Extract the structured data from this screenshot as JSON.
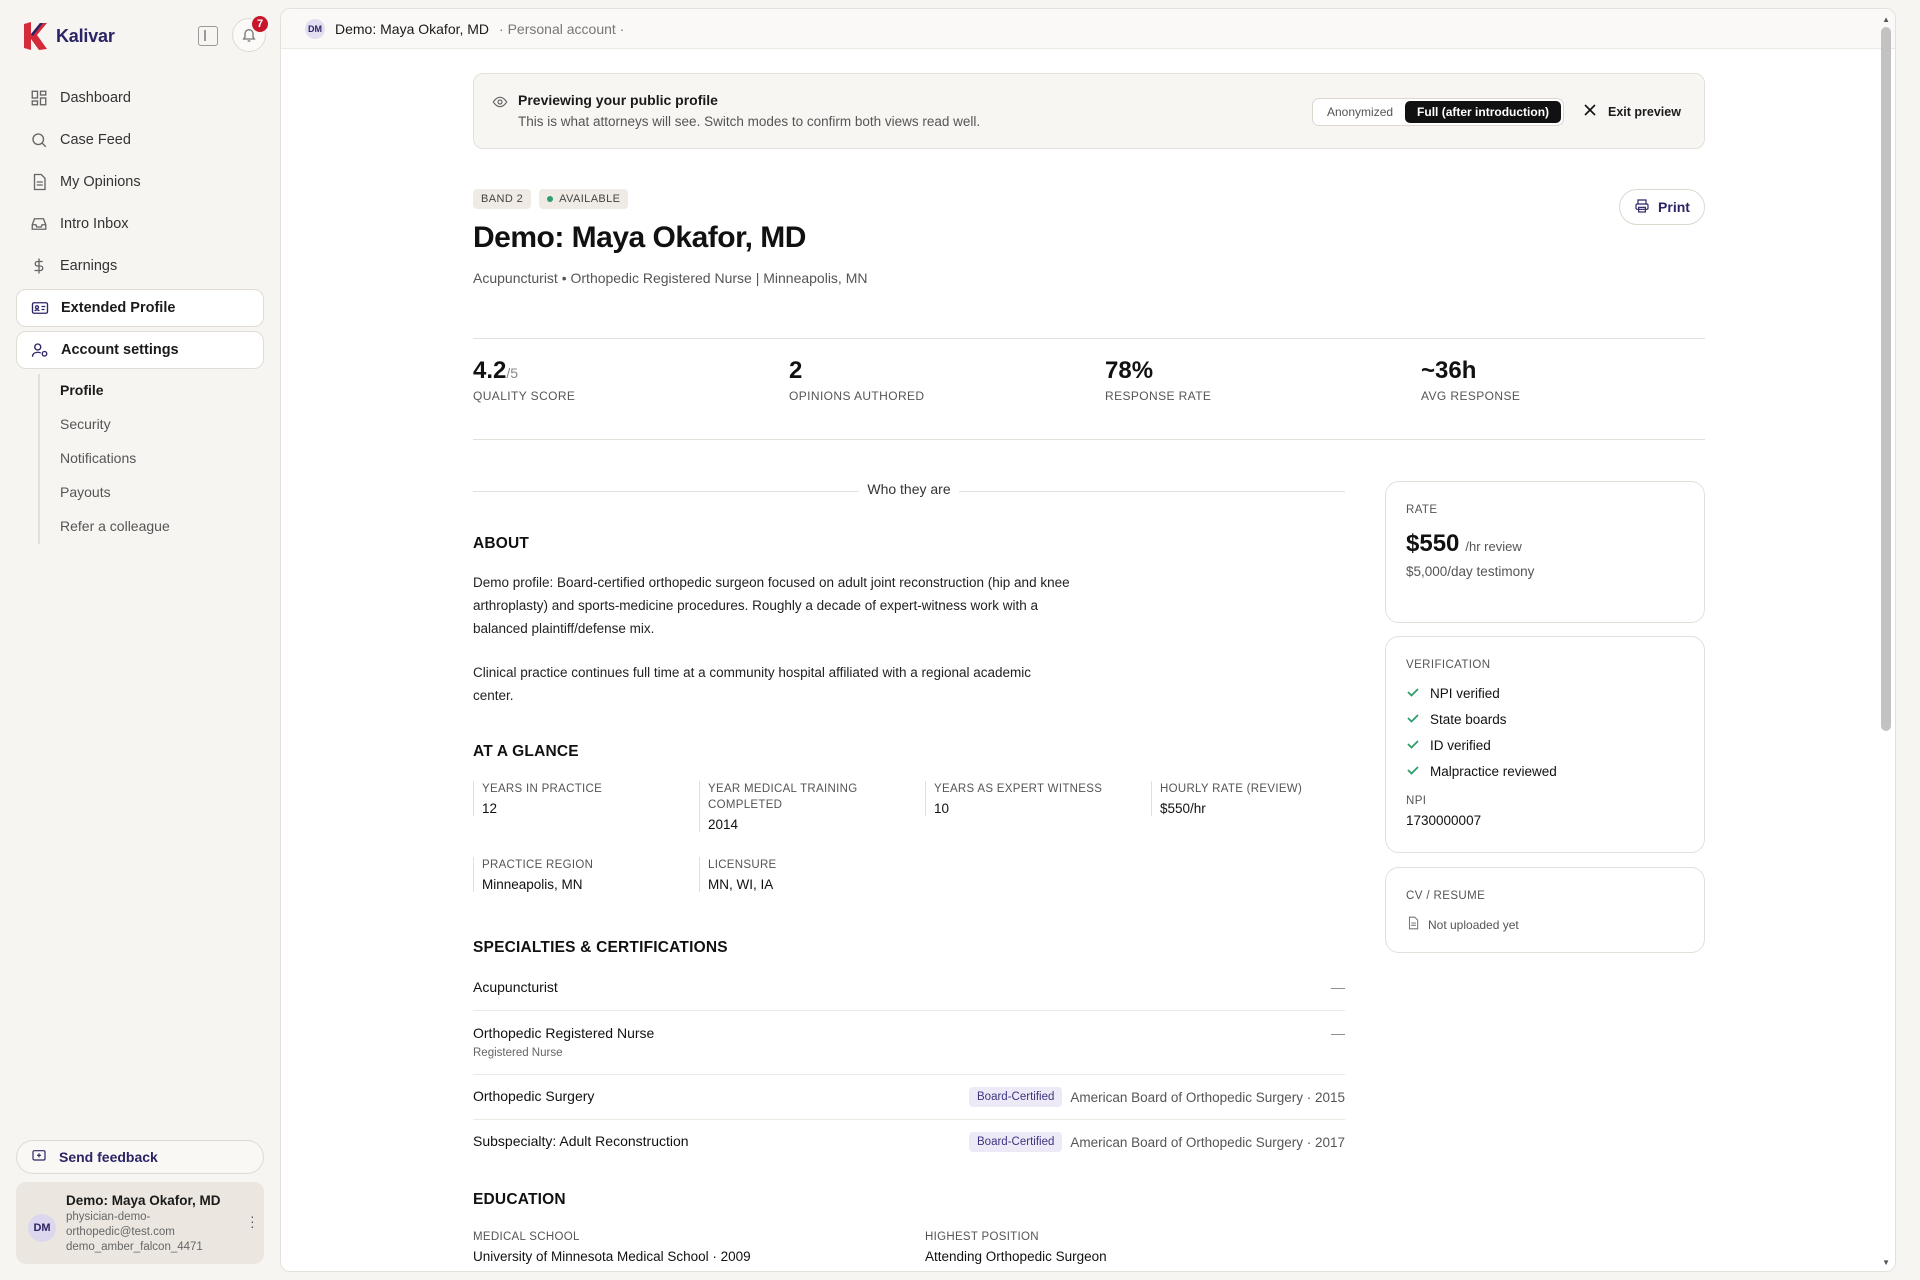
{
  "brand": {
    "name": "Kalivar"
  },
  "notifications": {
    "count": "7"
  },
  "nav": [
    {
      "label": "Dashboard",
      "icon": "grid-icon"
    },
    {
      "label": "Case Feed",
      "icon": "search-icon"
    },
    {
      "label": "My Opinions",
      "icon": "document-icon"
    },
    {
      "label": "Intro Inbox",
      "icon": "inbox-icon"
    },
    {
      "label": "Earnings",
      "icon": "dollar-icon"
    },
    {
      "label": "Extended Profile",
      "icon": "id-card-icon"
    },
    {
      "label": "Account settings",
      "icon": "user-settings-icon"
    }
  ],
  "subnav": [
    "Profile",
    "Security",
    "Notifications",
    "Payouts",
    "Refer a colleague"
  ],
  "feedback": {
    "label": "Send feedback"
  },
  "user": {
    "initials": "DM",
    "name": "Demo: Maya Okafor, MD",
    "email_line1": "physician-demo-",
    "email_line2": "orthopedic@test.com",
    "handle": "demo_amber_falcon_4471"
  },
  "topbar": {
    "initials": "DM",
    "name": "Demo: Maya Okafor, MD",
    "account": "· Personal account ·"
  },
  "banner": {
    "title": "Previewing your public profile",
    "subtitle": "This is what attorneys will see. Switch modes to confirm both views read well.",
    "mode_anon": "Anonymized",
    "mode_full": "Full (after introduction)",
    "exit": "Exit preview"
  },
  "profile": {
    "band": "BAND 2",
    "availability": "AVAILABLE",
    "print": "Print",
    "name": "Demo: Maya Okafor, MD",
    "subtitle": "Acupuncturist • Orthopedic Registered Nurse | Minneapolis, MN"
  },
  "stats": [
    {
      "value": "4.2",
      "suffix": "/5",
      "label": "QUALITY SCORE"
    },
    {
      "value": "2",
      "suffix": "",
      "label": "OPINIONS AUTHORED"
    },
    {
      "value": "78%",
      "suffix": "",
      "label": "RESPONSE RATE"
    },
    {
      "value": "~36h",
      "suffix": "",
      "label": "AVG RESPONSE"
    }
  ],
  "who": {
    "label": "Who they are"
  },
  "about": {
    "title": "ABOUT",
    "p1": "Demo profile: Board-certified orthopedic surgeon focused on adult joint reconstruction (hip and knee arthroplasty) and sports-medicine procedures. Roughly a decade of expert-witness work with a balanced plaintiff/defense mix.",
    "p2": "Clinical practice continues full time at a community hospital affiliated with a regional academic center."
  },
  "glance": {
    "title": "AT A GLANCE",
    "items": [
      {
        "label": "YEARS IN PRACTICE",
        "value": "12"
      },
      {
        "label": "YEAR MEDICAL TRAINING COMPLETED",
        "value": "2014"
      },
      {
        "label": "YEARS AS EXPERT WITNESS",
        "value": "10"
      },
      {
        "label": "HOURLY RATE (REVIEW)",
        "value": "$550/hr"
      },
      {
        "label": "PRACTICE REGION",
        "value": "Minneapolis, MN"
      },
      {
        "label": "LICENSURE",
        "value": "MN, WI, IA"
      }
    ]
  },
  "specialties": {
    "title": "SPECIALTIES & CERTIFICATIONS",
    "rows": [
      {
        "name": "Acupuncturist",
        "sub": "",
        "dash": "—"
      },
      {
        "name": "Orthopedic Registered Nurse",
        "sub": "Registered Nurse",
        "dash": "—"
      },
      {
        "name": "Orthopedic Surgery",
        "badge": "Board-Certified",
        "detail": "American Board of Orthopedic Surgery · 2015"
      },
      {
        "name": "Subspecialty: Adult Reconstruction",
        "badge": "Board-Certified",
        "detail": "American Board of Orthopedic Surgery · 2017"
      }
    ]
  },
  "education": {
    "title": "EDUCATION",
    "school_label": "MEDICAL SCHOOL",
    "school_value": "University of Minnesota Medical School · 2009",
    "position_label": "HIGHEST POSITION",
    "position_value": "Attending Orthopedic Surgeon"
  },
  "rate": {
    "label": "RATE",
    "amount": "$550",
    "unit": "/hr review",
    "testimony": "$5,000/day testimony"
  },
  "verification": {
    "label": "VERIFICATION",
    "items": [
      "NPI verified",
      "State boards",
      "ID verified",
      "Malpractice reviewed"
    ],
    "npi_label": "NPI",
    "npi_value": "1730000007"
  },
  "cv": {
    "label": "CV / RESUME",
    "status": "Not uploaded yet"
  },
  "colors": {
    "brand": "#2b2566",
    "accent_red": "#c6162b",
    "available": "#2e9e6b",
    "check": "#2e9e6b"
  }
}
